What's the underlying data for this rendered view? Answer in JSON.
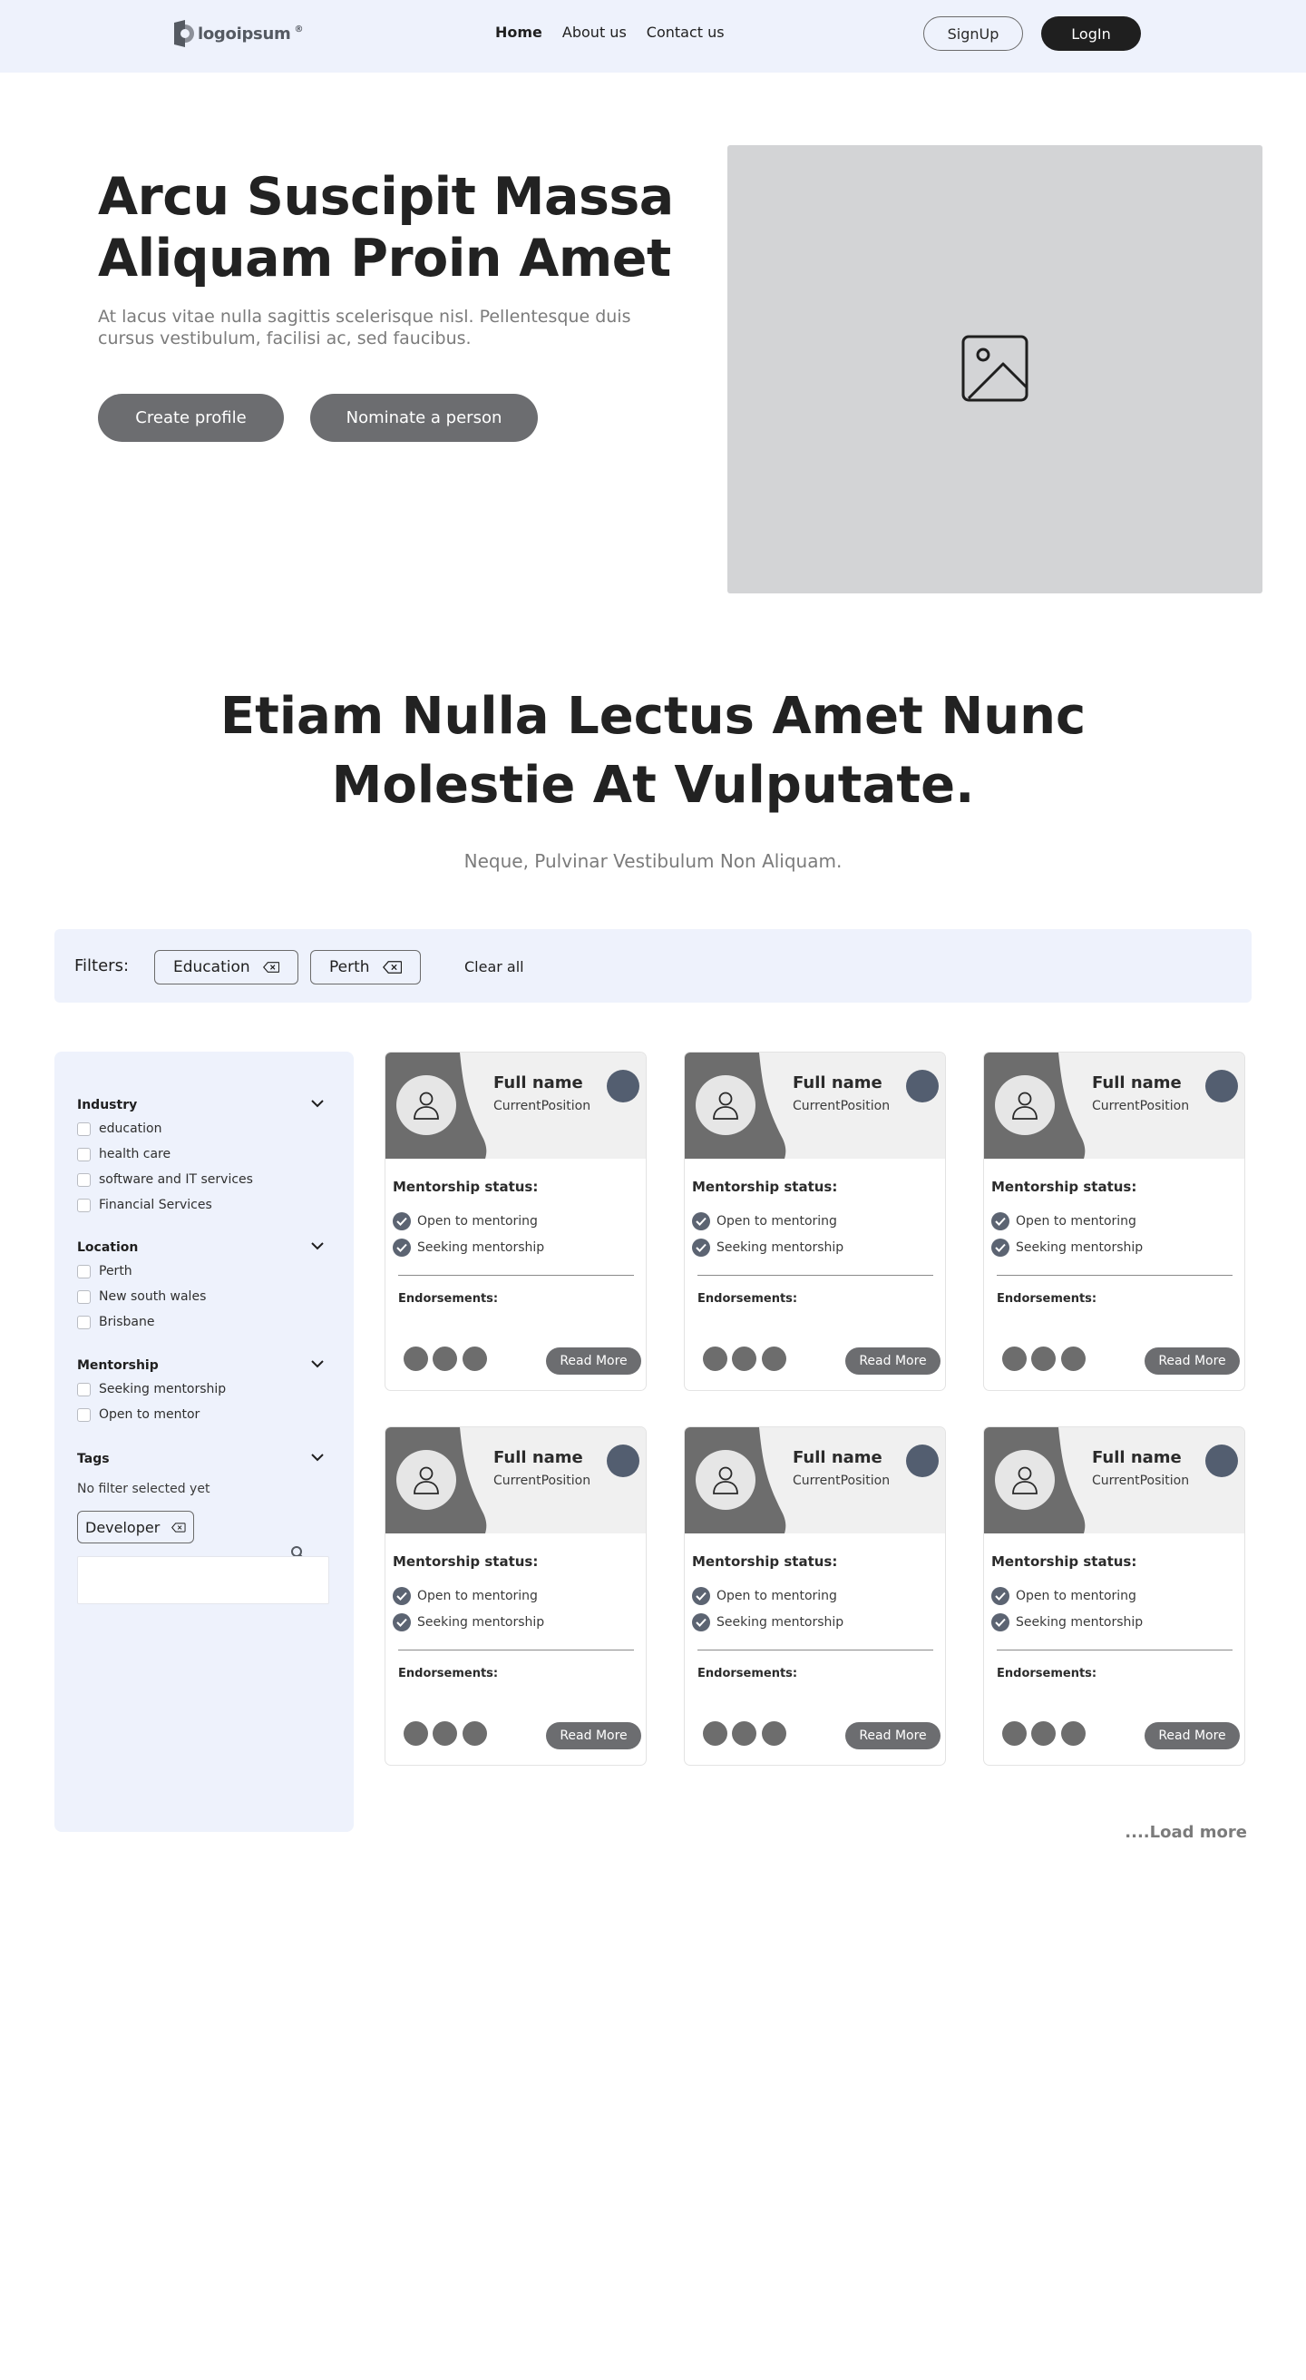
{
  "nav": {
    "logo_text": "logoipsum",
    "logo_mark": "®",
    "links": [
      {
        "label": "Home",
        "active": true
      },
      {
        "label": "About us",
        "active": false
      },
      {
        "label": "Contact us",
        "active": false
      }
    ],
    "signup_label": "SignUp",
    "login_label": "LogIn"
  },
  "hero": {
    "title": "Arcu Suscipit Massa Aliquam Proin Amet",
    "subtitle": "At lacus vitae nulla sagittis scelerisque nisl. Pellentesque duis cursus vestibulum, facilisi ac, sed faucibus.",
    "create_label": "Create profile",
    "nominate_label": "Nominate a person",
    "image_icon": "image-placeholder-icon"
  },
  "section": {
    "title": "Etiam Nulla Lectus Amet Nunc Molestie At Vulputate.",
    "subtitle": "Neque, Pulvinar Vestibulum Non Aliquam."
  },
  "filters": {
    "label": "Filters:",
    "chips": [
      "Education",
      "Perth"
    ],
    "clear_label": "Clear all"
  },
  "sidebar": {
    "industry": {
      "title": "Industry",
      "options": [
        "education",
        "health care",
        "software and IT services",
        "Financial Services"
      ]
    },
    "location": {
      "title": "Location",
      "options": [
        "Perth",
        "New south wales",
        "Brisbane"
      ]
    },
    "mentorship": {
      "title": "Mentorship",
      "options": [
        "Seeking mentorship",
        "Open to mentor"
      ]
    },
    "tags": {
      "title": "Tags",
      "note": "No filter selected yet",
      "chip": "Developer",
      "search_placeholder": ""
    }
  },
  "card_template": {
    "name": "Full name",
    "position": "CurrentPosition",
    "status_title": "Mentorship status:",
    "checks": [
      "Open to mentoring",
      "Seeking mentorship"
    ],
    "endorse_title": "Endorsements:",
    "read_more": "Read More"
  },
  "colors": {
    "nav_bg": "#eef2fc",
    "button_gray": "#6c6d70",
    "login_bg": "#1f1f1f",
    "card_dot": "#535e70",
    "image_placeholder": "#d3d4d6"
  },
  "load_more": "....Load more"
}
